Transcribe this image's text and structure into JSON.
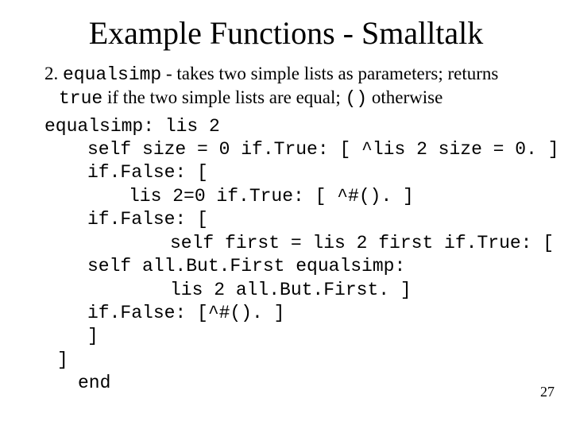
{
  "title": "Example Functions - Smalltalk",
  "desc": {
    "num": "2. ",
    "fn": "equalsimp",
    "part1": " - takes two simple lists as parameters; returns ",
    "true": "true",
    "part2": " if the two simple lists are equal; ",
    "empty": "()",
    "part3": " otherwise"
  },
  "code": {
    "l1": "equalsimp: lis 2",
    "l2": "self size = 0 if.True: [ ^lis 2 size = 0. ]",
    "l3": "if.False: [",
    "l4": "lis 2=0 if.True: [ ^#(). ]",
    "l5": "if.False: [",
    "l6": "self first = lis 2 first if.True: [",
    "l7": "self all.But.First equalsimp:",
    "l8": "lis 2 all.But.First. ]",
    "l9": "if.False: [^#(). ]",
    "l10": "]",
    "l11": "]",
    "l12": "end"
  },
  "page": "27"
}
